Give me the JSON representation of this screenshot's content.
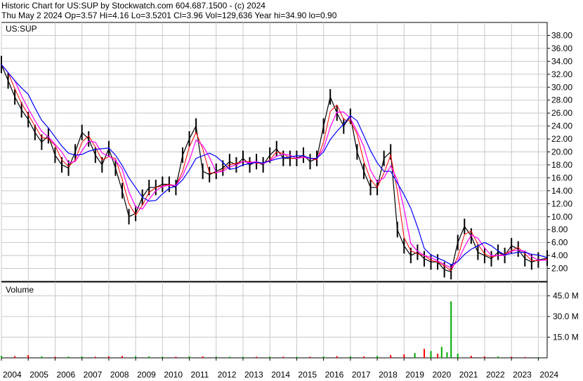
{
  "header": {
    "line1": "Historic Chart for US:SUP by Stockwatch.com 604.687.1500 - (c) 2024",
    "line2": "Thu May  2 2024  Op=3.57  Hi=4.16  Lo=3.5201  Cl=3.96  Vol=129,636  Year hi=34.90  lo=0.90"
  },
  "colors": {
    "price": "#000000",
    "ma_short": "#ff0000",
    "ma_mid": "#ff00ff",
    "ma_long": "#0000ff",
    "volume_up": "#00aa00",
    "volume_down": "#ff0000",
    "grid": "#c8c8c8"
  },
  "chart_data": [
    {
      "type": "line",
      "title": "US:SUP",
      "xlabel": "",
      "ylabel": "",
      "ylim": [
        0,
        40
      ],
      "y_ticks": [
        "38.00",
        "36.00",
        "34.00",
        "32.00",
        "30.00",
        "28.00",
        "26.00",
        "24.00",
        "22.00",
        "20.00",
        "18.00",
        "16.00",
        "14.00",
        "12.00",
        "10.00",
        "8.00",
        "6.00",
        "4.00",
        "2.00"
      ],
      "x_ticks": [
        "2004",
        "2005",
        "2006",
        "2007",
        "2008",
        "2009",
        "2010",
        "2011",
        "2012",
        "2013",
        "2014",
        "2015",
        "2016",
        "2017",
        "2018",
        "2019",
        "2020",
        "2021",
        "2022",
        "2023",
        "2024"
      ],
      "grid": true,
      "series_note": "price with short, mid and long moving averages",
      "x": [
        2004.0,
        2004.25,
        2004.5,
        2004.75,
        2005.0,
        2005.25,
        2005.5,
        2005.75,
        2006.0,
        2006.25,
        2006.5,
        2006.75,
        2007.0,
        2007.25,
        2007.5,
        2007.75,
        2008.0,
        2008.25,
        2008.5,
        2008.75,
        2009.0,
        2009.25,
        2009.5,
        2009.75,
        2010.0,
        2010.25,
        2010.5,
        2010.75,
        2011.0,
        2011.25,
        2011.5,
        2011.75,
        2012.0,
        2012.25,
        2012.5,
        2012.75,
        2013.0,
        2013.25,
        2013.5,
        2013.75,
        2014.0,
        2014.25,
        2014.5,
        2014.75,
        2015.0,
        2015.25,
        2015.5,
        2015.75,
        2016.0,
        2016.25,
        2016.5,
        2016.75,
        2017.0,
        2017.25,
        2017.5,
        2017.75,
        2018.0,
        2018.25,
        2018.5,
        2018.75,
        2019.0,
        2019.25,
        2019.5,
        2019.75,
        2020.0,
        2020.25,
        2020.5,
        2020.75,
        2021.0,
        2021.25,
        2021.5,
        2021.75,
        2022.0,
        2022.25,
        2022.5,
        2022.75,
        2023.0,
        2023.25,
        2023.5,
        2023.75,
        2024.0,
        2024.33
      ],
      "values": [
        33.5,
        31.0,
        28.5,
        26.5,
        25.0,
        23.0,
        21.5,
        22.5,
        19.5,
        18.0,
        17.5,
        20.0,
        23.0,
        22.0,
        19.5,
        18.0,
        20.5,
        17.5,
        14.0,
        10.0,
        10.5,
        13.0,
        14.5,
        14.5,
        15.0,
        15.0,
        14.5,
        19.5,
        22.0,
        24.0,
        17.0,
        16.5,
        17.0,
        17.5,
        18.5,
        18.0,
        19.0,
        18.0,
        18.5,
        18.0,
        19.5,
        20.5,
        19.0,
        19.0,
        19.0,
        19.5,
        18.5,
        19.0,
        24.0,
        28.5,
        26.0,
        24.0,
        25.5,
        20.0,
        17.0,
        14.5,
        14.5,
        19.0,
        20.0,
        8.0,
        5.5,
        4.0,
        4.5,
        3.5,
        3.0,
        3.0,
        1.8,
        1.5,
        6.0,
        8.5,
        7.0,
        4.5,
        4.0,
        3.5,
        4.5,
        4.0,
        5.5,
        5.0,
        3.5,
        3.0,
        3.3,
        3.6
      ]
    },
    {
      "type": "bar",
      "title": "Volume",
      "xlabel": "",
      "ylabel": "",
      "ylim": [
        0,
        55
      ],
      "y_ticks": [
        "45.0 M",
        "30.0 M",
        "15.0 M"
      ],
      "unit": "M",
      "grid": true,
      "x": [
        2004.0,
        2004.5,
        2005.0,
        2005.5,
        2006.0,
        2006.5,
        2007.0,
        2007.5,
        2008.0,
        2008.5,
        2009.0,
        2009.5,
        2010.0,
        2010.5,
        2011.0,
        2011.5,
        2012.0,
        2012.5,
        2013.0,
        2013.5,
        2014.0,
        2014.5,
        2015.0,
        2015.5,
        2016.0,
        2016.5,
        2017.0,
        2017.5,
        2018.0,
        2018.5,
        2019.0,
        2019.4,
        2019.75,
        2020.0,
        2020.25,
        2020.4,
        2020.6,
        2020.75,
        2021.0,
        2021.5,
        2022.0,
        2022.5,
        2023.0,
        2023.5,
        2024.0
      ],
      "values": [
        1.5,
        1.2,
        2.0,
        1.0,
        0.8,
        0.9,
        1.0,
        0.8,
        1.1,
        1.3,
        1.2,
        1.0,
        0.9,
        0.8,
        1.1,
        1.0,
        0.9,
        0.8,
        0.8,
        0.8,
        0.9,
        0.8,
        0.8,
        0.8,
        1.0,
        1.2,
        1.1,
        1.0,
        1.4,
        2.0,
        2.5,
        3.5,
        6.5,
        5.0,
        3.0,
        8.0,
        4.0,
        41.0,
        3.0,
        1.5,
        1.0,
        1.0,
        0.8,
        0.6,
        0.5
      ],
      "direction": [
        "up",
        "down",
        "down",
        "up",
        "down",
        "up",
        "up",
        "down",
        "down",
        "down",
        "up",
        "up",
        "up",
        "down",
        "up",
        "down",
        "up",
        "up",
        "up",
        "down",
        "up",
        "down",
        "up",
        "down",
        "up",
        "down",
        "up",
        "down",
        "up",
        "down",
        "down",
        "up",
        "down",
        "up",
        "down",
        "up",
        "up",
        "up",
        "up",
        "down",
        "down",
        "up",
        "down",
        "down",
        "up"
      ]
    }
  ]
}
